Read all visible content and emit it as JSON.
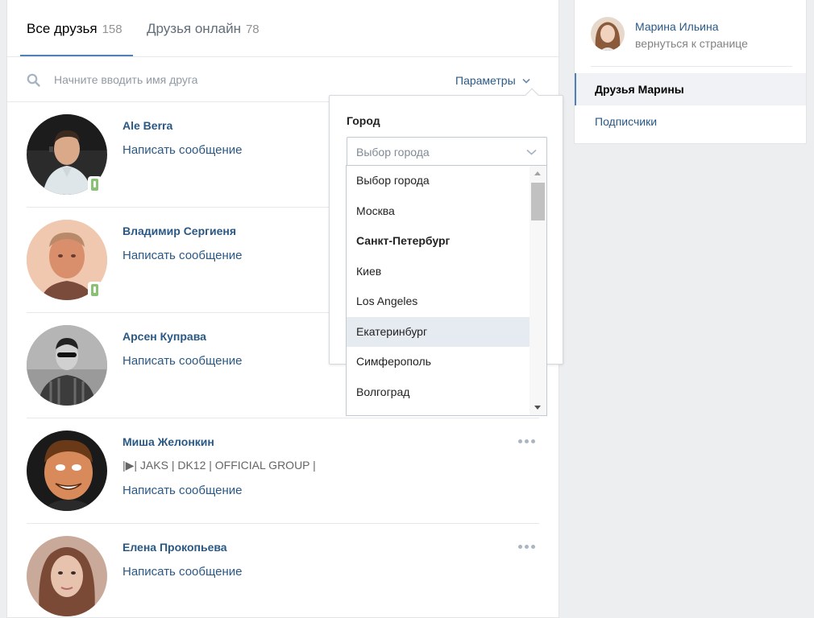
{
  "tabs": [
    {
      "label": "Все друзья",
      "count": "158"
    },
    {
      "label": "Друзья онлайн",
      "count": "78"
    }
  ],
  "search": {
    "placeholder": "Начните вводить имя друга",
    "params_label": "Параметры"
  },
  "friends": [
    {
      "name": "Ale Berra",
      "write": "Написать сообщение",
      "online_mobile": true
    },
    {
      "name": "Владимир Сергиеня",
      "write": "Написать сообщение",
      "online_mobile": true
    },
    {
      "name": "Арсен Куправа",
      "write": "Написать сообщение",
      "online_mobile": false
    },
    {
      "name": "Миша Желонкин",
      "status": "|▶| JAKS | DK12 | OFFICIAL GROUP |",
      "write": "Написать сообщение",
      "online_mobile": false
    },
    {
      "name": "Елена Прокопьева",
      "write": "Написать сообщение",
      "online_mobile": false
    }
  ],
  "filter": {
    "city_label": "Город",
    "city_select_placeholder": "Выбор города",
    "city_options": [
      {
        "label": "Выбор города",
        "bold": false,
        "hover": false
      },
      {
        "label": "Москва",
        "bold": false,
        "hover": false
      },
      {
        "label": "Санкт-Петербург",
        "bold": true,
        "hover": false
      },
      {
        "label": "Киев",
        "bold": false,
        "hover": false
      },
      {
        "label": "Los Angeles",
        "bold": false,
        "hover": false
      },
      {
        "label": "Екатеринбург",
        "bold": false,
        "hover": true
      },
      {
        "label": "Симферополь",
        "bold": false,
        "hover": false
      },
      {
        "label": "Волгоград",
        "bold": false,
        "hover": false
      }
    ]
  },
  "sidebar": {
    "owner_name": "Марина Ильина",
    "back_link": "вернуться к странице",
    "items": [
      {
        "label": "Друзья Марины",
        "active": true
      },
      {
        "label": "Подписчики",
        "active": false
      }
    ]
  },
  "colors": {
    "link": "#2a5885",
    "accent": "#5181b8",
    "background": "#edeef0",
    "online": "#8ac176"
  }
}
